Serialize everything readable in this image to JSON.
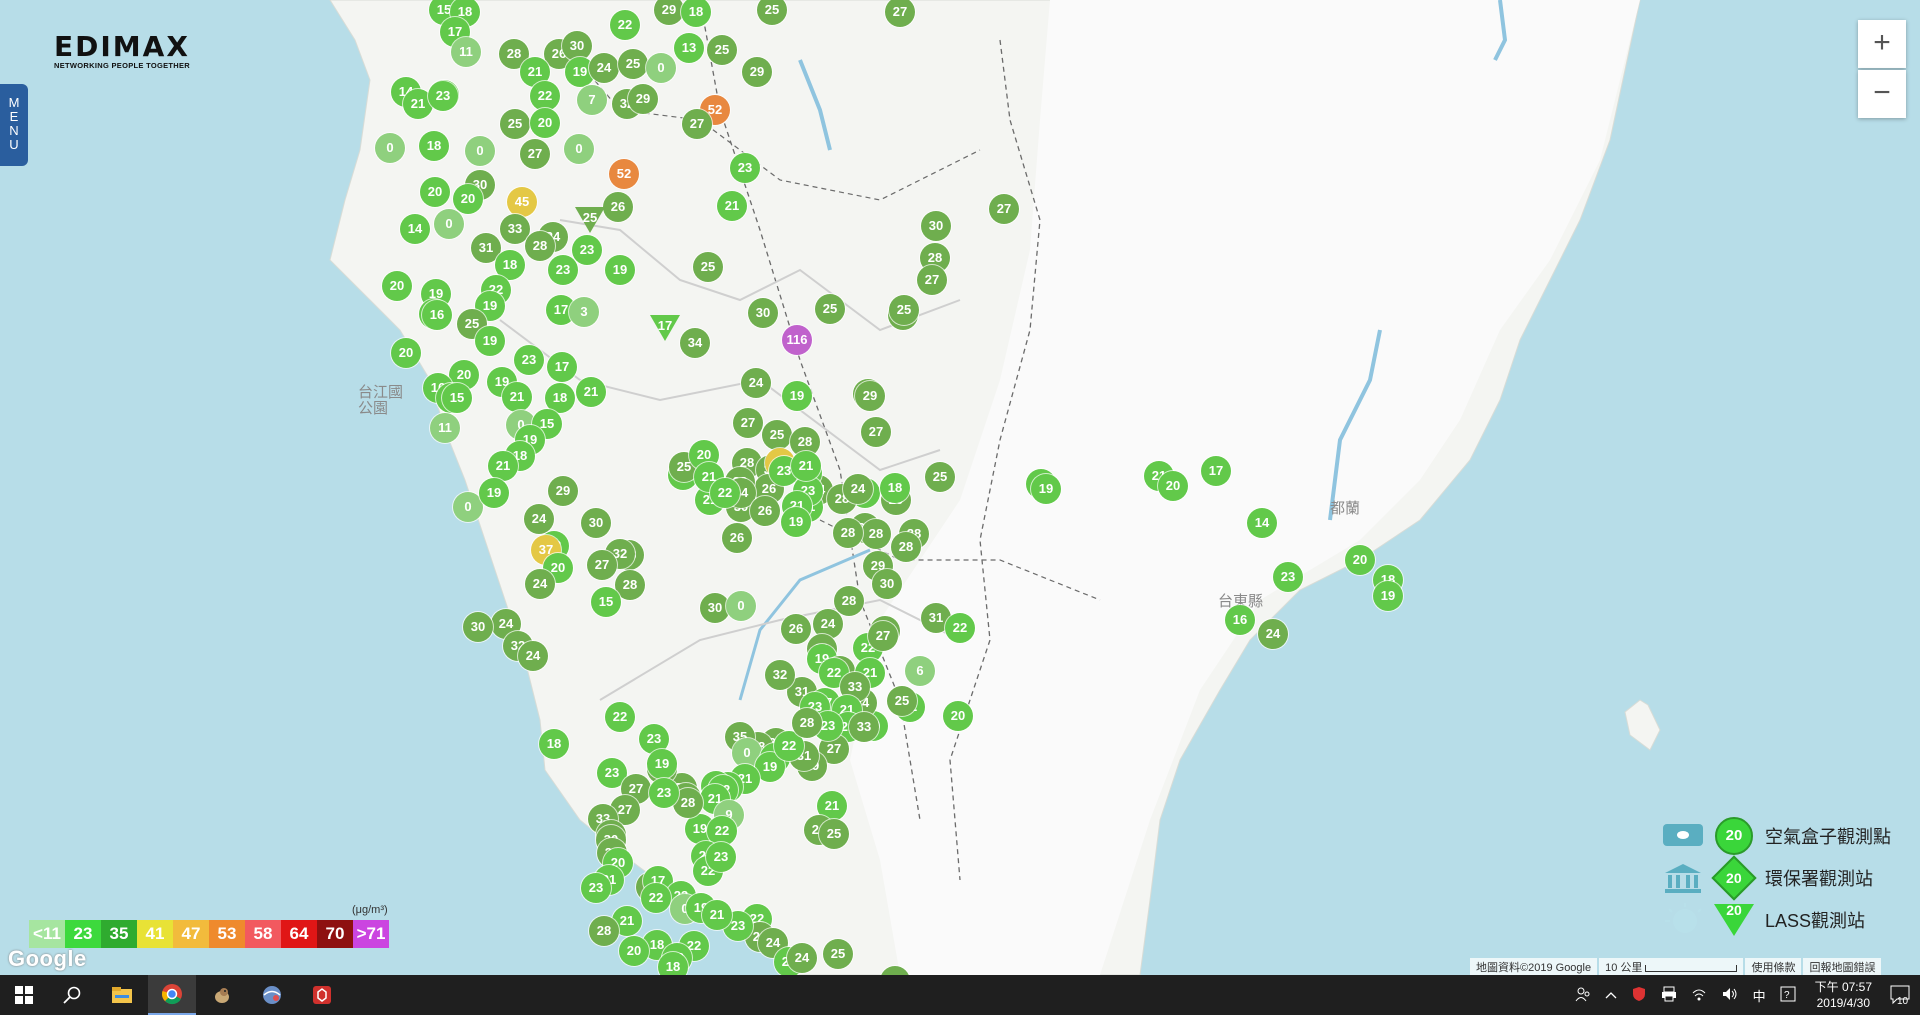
{
  "brand": {
    "name": "EDIMAX",
    "tagline": "NETWORKING PEOPLE TOGETHER"
  },
  "menu_tab": {
    "label": "MENU"
  },
  "zoom": {
    "in_label": "+",
    "out_label": "−"
  },
  "map_labels": [
    {
      "text": "台江國",
      "kind": "place"
    },
    {
      "text": "公園",
      "kind": "place"
    },
    {
      "text": "都蘭",
      "kind": "place"
    },
    {
      "text": "台東縣",
      "kind": "place"
    }
  ],
  "legend": {
    "items": [
      {
        "label": "空氣盒子觀測點",
        "symbol": "circle",
        "value": "20"
      },
      {
        "label": "環保署觀測站",
        "symbol": "diamond",
        "value": "20"
      },
      {
        "label": "LASS觀測站",
        "symbol": "triangle",
        "value": "20"
      }
    ]
  },
  "scale": {
    "unit": "(μg/m³)",
    "cells": [
      {
        "label": "<11",
        "color": "#a6e5a0"
      },
      {
        "label": "23",
        "color": "#3dd93d"
      },
      {
        "label": "35",
        "color": "#2fab2f"
      },
      {
        "label": "41",
        "color": "#e8e236"
      },
      {
        "label": "47",
        "color": "#f2bb3c"
      },
      {
        "label": "53",
        "color": "#ef8a2d"
      },
      {
        "label": "58",
        "color": "#f2595f"
      },
      {
        "label": "64",
        "color": "#e01616"
      },
      {
        "label": "70",
        "color": "#8e1010"
      },
      {
        "label": ">71",
        "color": "#cb45e0"
      }
    ]
  },
  "google_logo": "Google",
  "attribution": {
    "data": "地圖資料©2019 Google",
    "scale": "10 公里",
    "terms": "使用條款",
    "report": "回報地圖錯誤"
  },
  "marker_colors": {
    "light": "#8fd07e",
    "green": "#62c94a",
    "dark": "#6fae4e",
    "yellow": "#e4c845",
    "orange": "#e8883f",
    "purple": "#c062cc"
  },
  "markers": [
    {
      "v": "15",
      "c": "green"
    },
    {
      "v": "18",
      "c": "green"
    },
    {
      "v": "17",
      "c": "green"
    },
    {
      "v": "11",
      "c": "light"
    },
    {
      "v": "0",
      "c": "light"
    },
    {
      "v": "23",
      "c": "green"
    },
    {
      "v": "22",
      "c": "green"
    },
    {
      "v": "29",
      "c": "dark"
    },
    {
      "v": "18",
      "c": "green"
    },
    {
      "v": "25",
      "c": "dark"
    },
    {
      "v": "27",
      "c": "dark"
    },
    {
      "v": "28",
      "c": "dark"
    },
    {
      "v": "26",
      "c": "dark"
    },
    {
      "v": "30",
      "c": "dark"
    },
    {
      "v": "19",
      "c": "green"
    },
    {
      "v": "24",
      "c": "dark"
    },
    {
      "v": "25",
      "c": "dark"
    },
    {
      "v": "0",
      "c": "light"
    },
    {
      "v": "13",
      "c": "green"
    },
    {
      "v": "25",
      "c": "dark"
    },
    {
      "v": "29",
      "c": "dark"
    },
    {
      "v": "14",
      "c": "green"
    },
    {
      "v": "21",
      "c": "green"
    },
    {
      "v": "23",
      "c": "green"
    },
    {
      "v": "21",
      "c": "green"
    },
    {
      "v": "22",
      "c": "green"
    },
    {
      "v": "7",
      "c": "light"
    },
    {
      "v": "32",
      "c": "dark"
    },
    {
      "v": "29",
      "c": "dark"
    },
    {
      "v": "52",
      "c": "orange"
    },
    {
      "v": "27",
      "c": "dark"
    },
    {
      "v": "25",
      "c": "dark"
    },
    {
      "v": "20",
      "c": "green"
    },
    {
      "v": "0",
      "c": "light"
    },
    {
      "v": "18",
      "c": "green"
    },
    {
      "v": "27",
      "c": "dark"
    },
    {
      "v": "0",
      "c": "light"
    },
    {
      "v": "52",
      "c": "orange"
    },
    {
      "v": "23",
      "c": "green"
    },
    {
      "v": "30",
      "c": "dark"
    },
    {
      "v": "20",
      "c": "green"
    },
    {
      "v": "20",
      "c": "green"
    },
    {
      "v": "45",
      "c": "yellow"
    },
    {
      "v": "26",
      "c": "dark"
    },
    {
      "v": "21",
      "c": "green"
    },
    {
      "v": "14",
      "c": "green"
    },
    {
      "v": "0",
      "c": "light"
    },
    {
      "v": "33",
      "c": "dark"
    },
    {
      "v": "24",
      "c": "dark"
    },
    {
      "v": "31",
      "c": "dark"
    },
    {
      "v": "28",
      "c": "dark"
    },
    {
      "v": "23",
      "c": "green"
    },
    {
      "v": "18",
      "c": "green"
    },
    {
      "v": "23",
      "c": "green"
    },
    {
      "v": "19",
      "c": "green"
    },
    {
      "v": "25",
      "c": "dark"
    },
    {
      "v": "22",
      "c": "green"
    },
    {
      "v": "20",
      "c": "green"
    },
    {
      "v": "19",
      "c": "green"
    },
    {
      "v": "22",
      "c": "green"
    },
    {
      "v": "19",
      "c": "green"
    },
    {
      "v": "17",
      "c": "green"
    },
    {
      "v": "3",
      "c": "light"
    },
    {
      "v": "16",
      "c": "green"
    },
    {
      "v": "25",
      "c": "dark"
    },
    {
      "v": "20",
      "c": "green"
    },
    {
      "v": "19",
      "c": "green"
    },
    {
      "v": "23",
      "c": "green"
    },
    {
      "v": "17",
      "c": "green"
    },
    {
      "v": "34",
      "c": "dark"
    },
    {
      "v": "30",
      "c": "dark"
    },
    {
      "v": "25",
      "c": "dark"
    },
    {
      "v": "116",
      "c": "purple"
    },
    {
      "v": "28",
      "c": "dark"
    },
    {
      "v": "20",
      "c": "green"
    },
    {
      "v": "19",
      "c": "green"
    },
    {
      "v": "16",
      "c": "green"
    },
    {
      "v": "17",
      "c": "green"
    },
    {
      "v": "15",
      "c": "green"
    },
    {
      "v": "21",
      "c": "green"
    },
    {
      "v": "18",
      "c": "green"
    },
    {
      "v": "21",
      "c": "green"
    },
    {
      "v": "11",
      "c": "light"
    },
    {
      "v": "0",
      "c": "light"
    },
    {
      "v": "15",
      "c": "green"
    },
    {
      "v": "28",
      "c": "dark"
    },
    {
      "v": "24",
      "c": "dark"
    },
    {
      "v": "19",
      "c": "green"
    },
    {
      "v": "30",
      "c": "dark"
    },
    {
      "v": "28",
      "c": "dark"
    },
    {
      "v": "27",
      "c": "dark"
    },
    {
      "v": "27",
      "c": "dark"
    },
    {
      "v": "25",
      "c": "dark"
    },
    {
      "v": "29",
      "c": "dark"
    },
    {
      "v": "27",
      "c": "dark"
    },
    {
      "v": "28",
      "c": "dark"
    },
    {
      "v": "30",
      "c": "dark"
    },
    {
      "v": "23",
      "c": "green"
    },
    {
      "v": "25",
      "c": "dark"
    },
    {
      "v": "19",
      "c": "green"
    },
    {
      "v": "18",
      "c": "green"
    },
    {
      "v": "21",
      "c": "green"
    },
    {
      "v": "0",
      "c": "light"
    },
    {
      "v": "19",
      "c": "green"
    },
    {
      "v": "29",
      "c": "dark"
    },
    {
      "v": "18",
      "c": "green"
    },
    {
      "v": "24",
      "c": "dark"
    },
    {
      "v": "37",
      "c": "yellow"
    },
    {
      "v": "28",
      "c": "dark"
    },
    {
      "v": "25",
      "c": "dark"
    },
    {
      "v": "20",
      "c": "green"
    },
    {
      "v": "21",
      "c": "green"
    },
    {
      "v": "30",
      "c": "dark"
    },
    {
      "v": "28",
      "c": "dark"
    },
    {
      "v": "47",
      "c": "yellow"
    },
    {
      "v": "24",
      "c": "dark"
    },
    {
      "v": "26",
      "c": "dark"
    },
    {
      "v": "32",
      "c": "dark"
    },
    {
      "v": "15",
      "c": "green"
    },
    {
      "v": "25",
      "c": "dark"
    },
    {
      "v": "26",
      "c": "dark"
    },
    {
      "v": "29",
      "c": "dark"
    },
    {
      "v": "28",
      "c": "dark"
    },
    {
      "v": "28",
      "c": "dark"
    },
    {
      "v": "22",
      "c": "green"
    },
    {
      "v": "21",
      "c": "green"
    },
    {
      "v": "23",
      "c": "green"
    },
    {
      "v": "23",
      "c": "green"
    },
    {
      "v": "34",
      "c": "dark"
    },
    {
      "v": "18",
      "c": "green"
    },
    {
      "v": "21",
      "c": "green"
    },
    {
      "v": "28",
      "c": "dark"
    },
    {
      "v": "26",
      "c": "dark"
    },
    {
      "v": "24",
      "c": "dark"
    },
    {
      "v": "27",
      "c": "dark"
    },
    {
      "v": "28",
      "c": "dark"
    },
    {
      "v": "26",
      "c": "dark"
    },
    {
      "v": "29",
      "c": "dark"
    },
    {
      "v": "28",
      "c": "dark"
    },
    {
      "v": "30",
      "c": "dark"
    },
    {
      "v": "21",
      "c": "green"
    },
    {
      "v": "22",
      "c": "green"
    },
    {
      "v": "21",
      "c": "green"
    },
    {
      "v": "19",
      "c": "green"
    },
    {
      "v": "30",
      "c": "dark"
    },
    {
      "v": "32",
      "c": "dark"
    },
    {
      "v": "27",
      "c": "dark"
    },
    {
      "v": "20",
      "c": "green"
    },
    {
      "v": "28",
      "c": "dark"
    },
    {
      "v": "30",
      "c": "dark"
    },
    {
      "v": "24",
      "c": "dark"
    },
    {
      "v": "15",
      "c": "green"
    },
    {
      "v": "24",
      "c": "dark"
    },
    {
      "v": "30",
      "c": "dark"
    },
    {
      "v": "32",
      "c": "dark"
    },
    {
      "v": "24",
      "c": "dark"
    },
    {
      "v": "0",
      "c": "light"
    },
    {
      "v": "26",
      "c": "dark"
    },
    {
      "v": "30",
      "c": "dark"
    },
    {
      "v": "31",
      "c": "dark"
    },
    {
      "v": "22",
      "c": "green"
    },
    {
      "v": "6",
      "c": "light"
    },
    {
      "v": "22",
      "c": "green"
    },
    {
      "v": "20",
      "c": "green"
    },
    {
      "v": "24",
      "c": "dark"
    },
    {
      "v": "31",
      "c": "dark"
    },
    {
      "v": "19",
      "c": "green"
    },
    {
      "v": "28",
      "c": "dark"
    },
    {
      "v": "25",
      "c": "dark"
    },
    {
      "v": "22",
      "c": "green"
    },
    {
      "v": "22",
      "c": "green"
    },
    {
      "v": "21",
      "c": "green"
    },
    {
      "v": "27",
      "c": "dark"
    },
    {
      "v": "20",
      "c": "green"
    },
    {
      "v": "25",
      "c": "dark"
    },
    {
      "v": "24",
      "c": "dark"
    },
    {
      "v": "31",
      "c": "dark"
    },
    {
      "v": "32",
      "c": "dark"
    },
    {
      "v": "33",
      "c": "dark"
    },
    {
      "v": "17",
      "c": "green"
    },
    {
      "v": "23",
      "c": "green"
    },
    {
      "v": "21",
      "c": "green"
    },
    {
      "v": "21",
      "c": "green"
    },
    {
      "v": "33",
      "c": "dark"
    },
    {
      "v": "27",
      "c": "dark"
    },
    {
      "v": "29",
      "c": "dark"
    },
    {
      "v": "21",
      "c": "green"
    },
    {
      "v": "24",
      "c": "dark"
    },
    {
      "v": "25",
      "c": "dark"
    },
    {
      "v": "23",
      "c": "green"
    },
    {
      "v": "31",
      "c": "dark"
    },
    {
      "v": "32",
      "c": "dark"
    },
    {
      "v": "28",
      "c": "dark"
    },
    {
      "v": "35",
      "c": "dark"
    },
    {
      "v": "0",
      "c": "light"
    },
    {
      "v": "20",
      "c": "green"
    },
    {
      "v": "19",
      "c": "green"
    },
    {
      "v": "22",
      "c": "green"
    },
    {
      "v": "28",
      "c": "dark"
    },
    {
      "v": "21",
      "c": "green"
    },
    {
      "v": "23",
      "c": "green"
    },
    {
      "v": "34",
      "c": "dark"
    },
    {
      "v": "33",
      "c": "dark"
    },
    {
      "v": "12",
      "c": "green"
    },
    {
      "v": "22",
      "c": "green"
    },
    {
      "v": "21",
      "c": "green"
    },
    {
      "v": "9",
      "c": "light"
    },
    {
      "v": "19",
      "c": "green"
    },
    {
      "v": "22",
      "c": "green"
    },
    {
      "v": "21",
      "c": "green"
    },
    {
      "v": "22",
      "c": "green"
    },
    {
      "v": "23",
      "c": "green"
    },
    {
      "v": "23",
      "c": "green"
    },
    {
      "v": "27",
      "c": "dark"
    },
    {
      "v": "28",
      "c": "dark"
    },
    {
      "v": "22",
      "c": "green"
    },
    {
      "v": "18",
      "c": "green"
    },
    {
      "v": "23",
      "c": "green"
    },
    {
      "v": "27",
      "c": "dark"
    },
    {
      "v": "19",
      "c": "green"
    },
    {
      "v": "23",
      "c": "green"
    },
    {
      "v": "27",
      "c": "dark"
    },
    {
      "v": "33",
      "c": "dark"
    },
    {
      "v": "29",
      "c": "dark"
    },
    {
      "v": "30",
      "c": "dark"
    },
    {
      "v": "24",
      "c": "dark"
    },
    {
      "v": "20",
      "c": "green"
    },
    {
      "v": "21",
      "c": "green"
    },
    {
      "v": "23",
      "c": "green"
    },
    {
      "v": "25",
      "c": "dark"
    },
    {
      "v": "17",
      "c": "green"
    },
    {
      "v": "23",
      "c": "green"
    },
    {
      "v": "22",
      "c": "green"
    },
    {
      "v": "26",
      "c": "dark"
    },
    {
      "v": "22",
      "c": "green"
    },
    {
      "v": "23",
      "c": "green"
    },
    {
      "v": "24",
      "c": "dark"
    },
    {
      "v": "22",
      "c": "green"
    },
    {
      "v": "24",
      "c": "dark"
    },
    {
      "v": "0",
      "c": "light"
    },
    {
      "v": "22",
      "c": "green"
    },
    {
      "v": "19",
      "c": "green"
    },
    {
      "v": "21",
      "c": "green"
    },
    {
      "v": "28",
      "c": "dark"
    },
    {
      "v": "18",
      "c": "green"
    },
    {
      "v": "20",
      "c": "green"
    },
    {
      "v": "20",
      "c": "green"
    },
    {
      "v": "18",
      "c": "green"
    },
    {
      "v": "21",
      "c": "green"
    },
    {
      "v": "25",
      "c": "dark"
    },
    {
      "v": "26",
      "c": "dark"
    },
    {
      "v": "15",
      "c": "green"
    },
    {
      "v": "19",
      "c": "green"
    },
    {
      "v": "21",
      "c": "green"
    },
    {
      "v": "20",
      "c": "green"
    },
    {
      "v": "17",
      "c": "green"
    },
    {
      "v": "14",
      "c": "green"
    },
    {
      "v": "23",
      "c": "green"
    },
    {
      "v": "20",
      "c": "green"
    },
    {
      "v": "18",
      "c": "green"
    },
    {
      "v": "19",
      "c": "green"
    },
    {
      "v": "16",
      "c": "green"
    },
    {
      "v": "24",
      "c": "dark"
    }
  ],
  "triangle_markers": [
    {
      "v": "25",
      "c": "dark"
    },
    {
      "v": "17",
      "c": "green"
    }
  ],
  "taskbar": {
    "ime": "中",
    "time": "下午 07:57",
    "date": "2019/4/30",
    "notifications": "10"
  }
}
